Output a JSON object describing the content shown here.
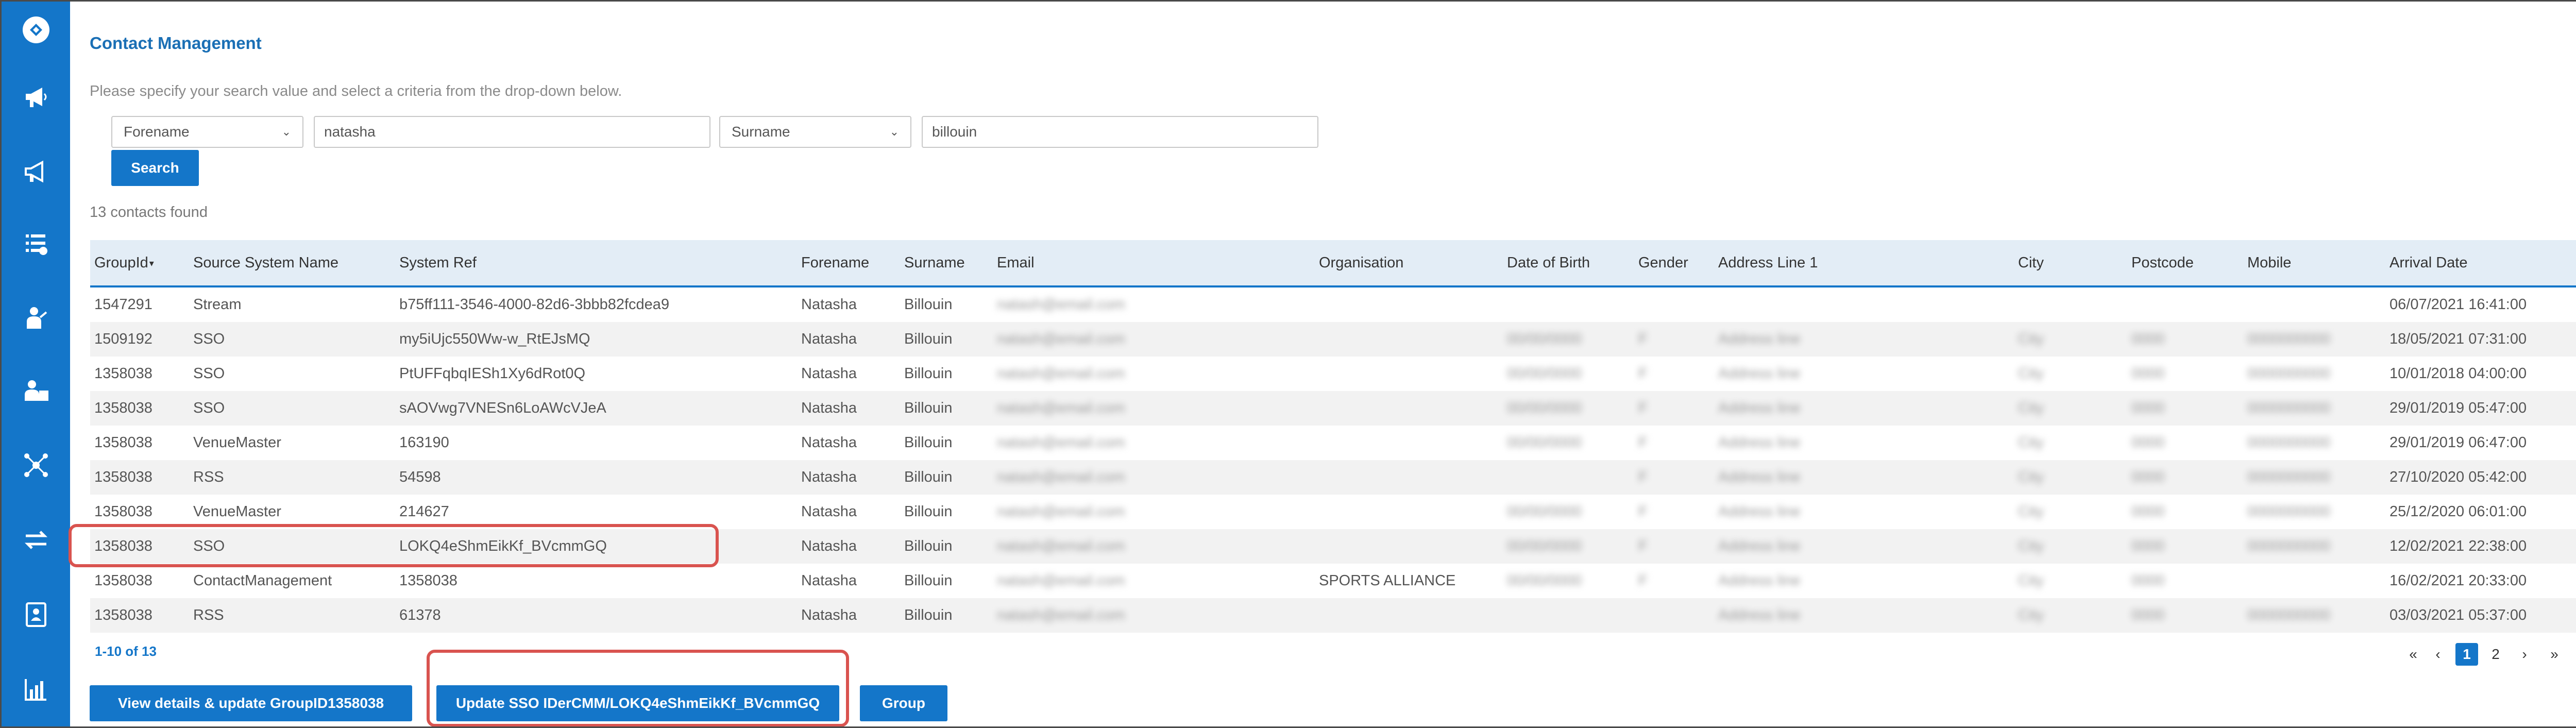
{
  "sidebar": {
    "items": [
      {
        "icon": "logo-icon"
      },
      {
        "icon": "megaphone-icon"
      },
      {
        "icon": "megaphone-outline-icon"
      },
      {
        "icon": "task-list-icon"
      },
      {
        "icon": "presenter-icon"
      },
      {
        "icon": "user-board-icon"
      },
      {
        "icon": "network-icon"
      },
      {
        "icon": "transfer-arrows-icon"
      },
      {
        "icon": "contact-card-icon"
      },
      {
        "icon": "bar-chart-icon"
      }
    ],
    "color": "#1476c9"
  },
  "header": {
    "title": "Contact Management",
    "instructions": "Please specify your search value and select a criteria from the drop-down below."
  },
  "search": {
    "criteria1": "Forename",
    "value1": "natasha",
    "criteria2": "Surname",
    "value2": "billouin",
    "button_label": "Search"
  },
  "results": {
    "count_label": "13 contacts found",
    "columns": [
      "GroupId",
      "Source System Name",
      "System Ref",
      "Forename",
      "Surname",
      "Email",
      "Organisation",
      "Date of Birth",
      "Gender",
      "Address Line 1",
      "City",
      "Postcode",
      "Mobile",
      "Arrival Date"
    ],
    "rows": [
      {
        "group_id": "1547291",
        "source": "Stream",
        "system_ref": "b75ff111-3546-4000-82d6-3bbb82fcdea9",
        "forename": "Natasha",
        "surname": "Billouin",
        "email": "natash@email.com",
        "organisation": "",
        "dob": "",
        "gender": "",
        "address": "",
        "city": "",
        "postcode": "",
        "mobile": "",
        "arrival": "06/07/2021 16:41:00"
      },
      {
        "group_id": "1509192",
        "source": "SSO",
        "system_ref": "my5iUjc550Ww-w_RtEJsMQ",
        "forename": "Natasha",
        "surname": "Billouin",
        "email": "natash@email.com",
        "organisation": "",
        "dob": "00/00/0000",
        "gender": "F",
        "address": "Address line",
        "city": "City",
        "postcode": "0000",
        "mobile": "0000000000",
        "arrival": "18/05/2021 07:31:00"
      },
      {
        "group_id": "1358038",
        "source": "SSO",
        "system_ref": "PtUFFqbqIESh1Xy6dRot0Q",
        "forename": "Natasha",
        "surname": "Billouin",
        "email": "natash@email.com",
        "organisation": "",
        "dob": "00/00/0000",
        "gender": "F",
        "address": "Address line",
        "city": "City",
        "postcode": "0000",
        "mobile": "0000000000",
        "arrival": "10/01/2018 04:00:00"
      },
      {
        "group_id": "1358038",
        "source": "SSO",
        "system_ref": "sAOVwg7VNESn6LoAWcVJeA",
        "forename": "Natasha",
        "surname": "Billouin",
        "email": "natash@email.com",
        "organisation": "",
        "dob": "00/00/0000",
        "gender": "F",
        "address": "Address line",
        "city": "City",
        "postcode": "0000",
        "mobile": "0000000000",
        "arrival": "29/01/2019 05:47:00"
      },
      {
        "group_id": "1358038",
        "source": "VenueMaster",
        "system_ref": "163190",
        "forename": "Natasha",
        "surname": "Billouin",
        "email": "natash@email.com",
        "organisation": "",
        "dob": "00/00/0000",
        "gender": "F",
        "address": "Address line",
        "city": "City",
        "postcode": "0000",
        "mobile": "0000000000",
        "arrival": "29/01/2019 06:47:00"
      },
      {
        "group_id": "1358038",
        "source": "RSS",
        "system_ref": "54598",
        "forename": "Natasha",
        "surname": "Billouin",
        "email": "natash@email.com",
        "organisation": "",
        "dob": "",
        "gender": "F",
        "address": "Address line",
        "city": "City",
        "postcode": "0000",
        "mobile": "0000000000",
        "arrival": "27/10/2020 05:42:00"
      },
      {
        "group_id": "1358038",
        "source": "VenueMaster",
        "system_ref": "214627",
        "forename": "Natasha",
        "surname": "Billouin",
        "email": "natash@email.com",
        "organisation": "",
        "dob": "00/00/0000",
        "gender": "F",
        "address": "Address line",
        "city": "City",
        "postcode": "0000",
        "mobile": "0000000000",
        "arrival": "25/12/2020 06:01:00"
      },
      {
        "group_id": "1358038",
        "source": "SSO",
        "system_ref": "LOKQ4eShmEikKf_BVcmmGQ",
        "forename": "Natasha",
        "surname": "Billouin",
        "email": "natash@email.com",
        "organisation": "",
        "dob": "00/00/0000",
        "gender": "F",
        "address": "Address line",
        "city": "City",
        "postcode": "0000",
        "mobile": "0000000000",
        "arrival": "12/02/2021 22:38:00"
      },
      {
        "group_id": "1358038",
        "source": "ContactManagement",
        "system_ref": "1358038",
        "forename": "Natasha",
        "surname": "Billouin",
        "email": "natash@email.com",
        "organisation": "SPORTS ALLIANCE",
        "dob": "00/00/0000",
        "gender": "F",
        "address": "Address line",
        "city": "City",
        "postcode": "0000",
        "mobile": "",
        "arrival": "16/02/2021 20:33:00"
      },
      {
        "group_id": "1358038",
        "source": "RSS",
        "system_ref": "61378",
        "forename": "Natasha",
        "surname": "Billouin",
        "email": "natash@email.com",
        "organisation": "",
        "dob": "",
        "gender": "",
        "address": "Address line",
        "city": "City",
        "postcode": "0000",
        "mobile": "0000000000",
        "arrival": "03/03/2021 05:37:00"
      }
    ]
  },
  "pagination": {
    "range_label": "1-10 of 13",
    "first": "«",
    "prev": "‹",
    "pages": [
      "1",
      "2"
    ],
    "next": "›",
    "last": "»",
    "current": "1"
  },
  "actions": {
    "view_details_label": "View details & update GroupID1358038",
    "update_sso_label": "Update SSO IDerCMM/LOKQ4eShmEikKf_BVcmmGQ",
    "group_label": "Group"
  },
  "colors": {
    "accent": "#1476c9",
    "highlight": "#d9534f",
    "header_bg": "#e3edf6"
  }
}
